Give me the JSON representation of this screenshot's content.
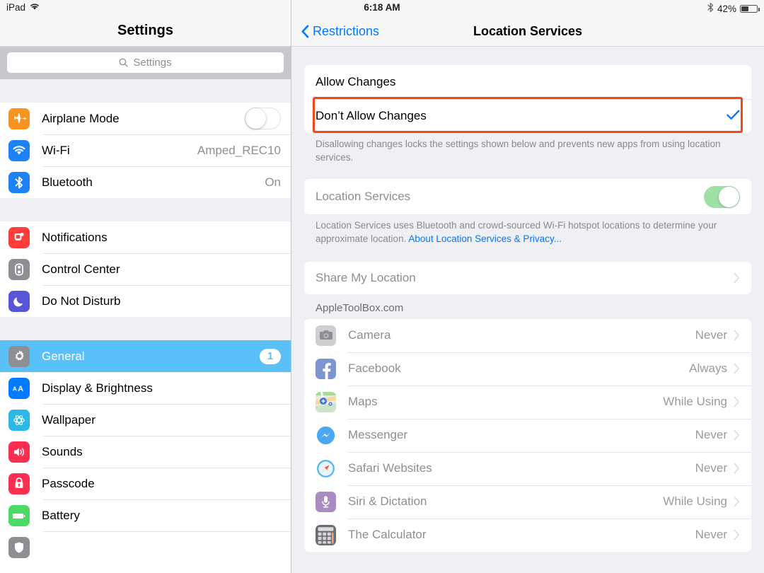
{
  "status_bar": {
    "device": "iPad",
    "wifi_icon": "wifi-icon",
    "time": "6:18 AM",
    "bluetooth_icon": "bluetooth-icon",
    "battery_percent": "42%",
    "battery_level": 42
  },
  "sidebar": {
    "title": "Settings",
    "search": {
      "placeholder": "Settings",
      "value": "",
      "icon": "search-icon"
    },
    "groups": [
      {
        "items": [
          {
            "label": "Airplane Mode",
            "icon": "airplane-icon",
            "icon_color": "#f79421",
            "control": "toggle",
            "toggle_on": false
          },
          {
            "label": "Wi-Fi",
            "icon": "wifi-icon",
            "icon_color": "#1d82f5",
            "value": "Amped_REC10"
          },
          {
            "label": "Bluetooth",
            "icon": "bluetooth-icon",
            "icon_color": "#1d82f5",
            "value": "On"
          }
        ]
      },
      {
        "items": [
          {
            "label": "Notifications",
            "icon": "notifications-icon",
            "icon_color": "#fc3d39"
          },
          {
            "label": "Control Center",
            "icon": "control-center-icon",
            "icon_color": "#8e8e93"
          },
          {
            "label": "Do Not Disturb",
            "icon": "moon-icon",
            "icon_color": "#5856d6"
          }
        ]
      },
      {
        "items": [
          {
            "label": "General",
            "icon": "gear-icon",
            "icon_color": "#8e8e93",
            "selected": true,
            "badge": "1"
          },
          {
            "label": "Display & Brightness",
            "icon": "display-brightness-icon",
            "icon_color": "#007aff"
          },
          {
            "label": "Wallpaper",
            "icon": "wallpaper-icon",
            "icon_color": "#2bb8e6"
          },
          {
            "label": "Sounds",
            "icon": "sounds-icon",
            "icon_color": "#fc2e52"
          },
          {
            "label": "Passcode",
            "icon": "lock-icon",
            "icon_color": "#fc2e52"
          },
          {
            "label": "Battery",
            "icon": "battery-icon",
            "icon_color": "#4cd964"
          },
          {
            "label": "",
            "icon": "privacy-icon",
            "icon_color": "#8e8e93"
          }
        ]
      }
    ]
  },
  "detail": {
    "back_label": "Restrictions",
    "back_icon": "chevron-left-icon",
    "title": "Location Services",
    "allow_changes": {
      "options": [
        {
          "label": "Allow Changes",
          "checked": false
        },
        {
          "label": "Don’t Allow Changes",
          "checked": true,
          "highlighted": true,
          "highlight_color": "#f4471c"
        }
      ],
      "footnote": "Disallowing changes locks the settings shown below and prevents new apps from using location services."
    },
    "location_services": {
      "label": "Location Services",
      "toggle_on": true,
      "toggle_disabled": true,
      "footnote_text": "Location Services uses Bluetooth and crowd-sourced Wi-Fi hotspot locations to determine your approximate location. ",
      "footnote_link": "About Location Services & Privacy..."
    },
    "share_my_location": {
      "label": "Share My Location",
      "chevron": "chevron-right-icon"
    },
    "apps_group_label": "AppleToolBox.com",
    "apps": [
      {
        "name": "Camera",
        "value": "Never",
        "icon": "camera-app-icon"
      },
      {
        "name": "Facebook",
        "value": "Always",
        "icon": "facebook-app-icon"
      },
      {
        "name": "Maps",
        "value": "While Using",
        "icon": "maps-app-icon"
      },
      {
        "name": "Messenger",
        "value": "Never",
        "icon": "messenger-app-icon"
      },
      {
        "name": "Safari Websites",
        "value": "Never",
        "icon": "safari-app-icon"
      },
      {
        "name": "Siri & Dictation",
        "value": "While Using",
        "icon": "siri-dictation-icon"
      },
      {
        "name": "The Calculator",
        "value": "Never",
        "icon": "calculator-app-icon"
      }
    ]
  },
  "colors": {
    "accent_blue": "#007aff",
    "selection_blue": "#5ac0f8",
    "highlight_red": "#f4471c",
    "toggle_green": "#9fe0a6",
    "background_grey": "#efeff4"
  }
}
